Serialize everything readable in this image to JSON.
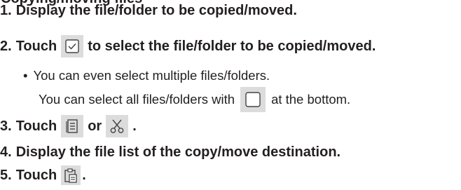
{
  "heading": "Copying/moving files",
  "steps": [
    {
      "num": "1.",
      "text": "Display the file/folder to be copied/moved."
    },
    {
      "num": "2.",
      "pre": "Touch",
      "post": "to select the file/folder to be copied/moved."
    },
    {
      "num": "3.",
      "pre": "Touch",
      "mid": "or",
      "post": "."
    },
    {
      "num": "4.",
      "text": "Display the file list of the copy/move destination."
    },
    {
      "num": "5.",
      "pre": "Touch",
      "post": "."
    }
  ],
  "notes": {
    "bullet": "•",
    "line1": "You can even select multiple files/folders.",
    "line2_pre": "You can select all files/folders with",
    "line2_post": "at the bottom."
  },
  "icons": {
    "select": "checkbox-checked-icon",
    "select_all": "checkbox-empty-icon",
    "copy": "copy-document-icon",
    "cut": "scissors-icon",
    "paste": "paste-clipboard-icon"
  },
  "colors": {
    "text": "#231f20",
    "icon_bg": "#dcdcdc"
  }
}
